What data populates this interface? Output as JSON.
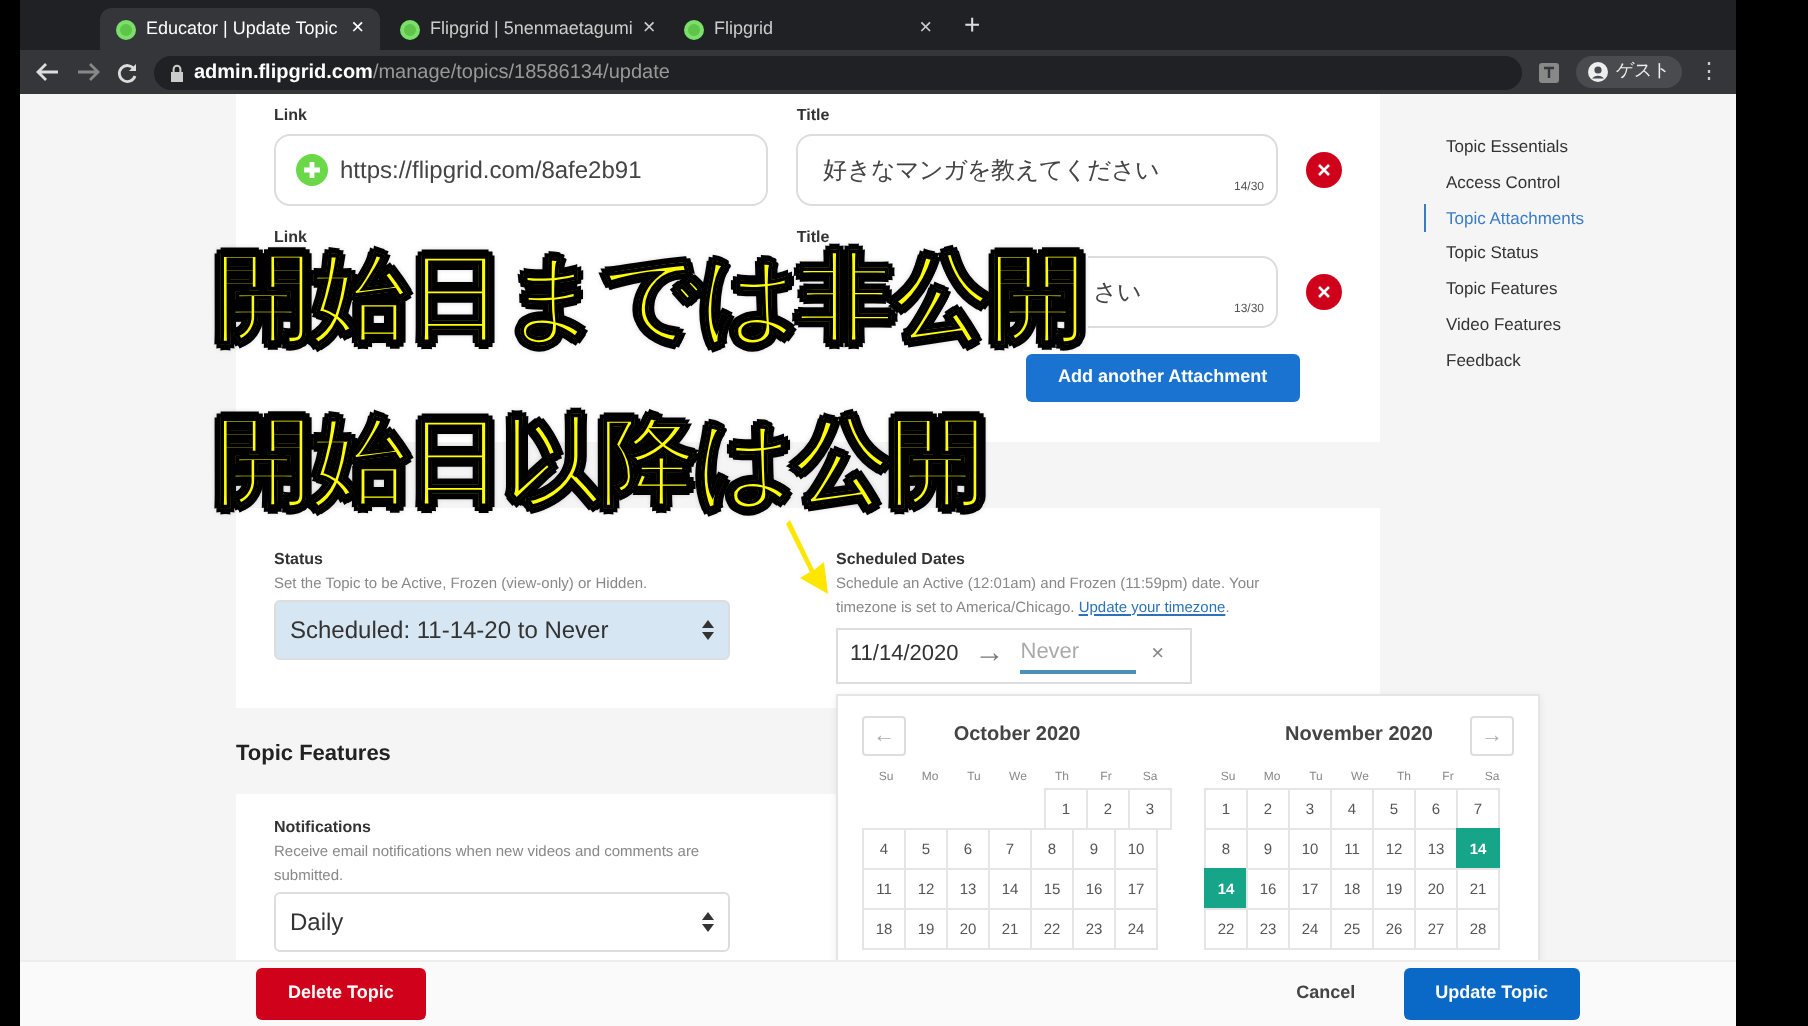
{
  "browser": {
    "tabs": [
      {
        "title": "Educator | Update Topic",
        "close": "×",
        "selected": true
      },
      {
        "title": "Flipgrid | 5nenmaetagumi",
        "close": "×",
        "selected": false
      },
      {
        "title": "Flipgrid",
        "close": "×",
        "selected": false
      }
    ],
    "new_tab": "+",
    "url_host": "admin.flipgrid.com",
    "url_path": "/manage/topics/18586134/update",
    "profile": "ゲスト",
    "menu": "⋮"
  },
  "attachments": [
    {
      "link_label": "Link",
      "link": "https://flipgrid.com/8afe2b91",
      "title_label": "Title",
      "title": "好きなマンガを教えてください",
      "count": "14/30",
      "covered": false
    },
    {
      "link_label": "Link",
      "title_label": "Title",
      "title": "さい",
      "count": "13/30",
      "covered": true
    }
  ],
  "add_button": "Add another Attachment",
  "caption": [
    "開始日までは非公開",
    "開始日以降は公開"
  ],
  "status": {
    "label": "Status",
    "description": "Set the Topic to be Active, Frozen (view-only) or Hidden.",
    "value": "Scheduled: 11-14-20 to Never"
  },
  "scheduled": {
    "label": "Scheduled Dates",
    "description": "Schedule an Active (12:01am) and Frozen (11:59pm) date. Your timezone is set to America/Chicago. ",
    "link": "Update your timezone",
    "suffix": ".",
    "start": "11/14/2020",
    "arrow": "→",
    "end_placeholder": "Never",
    "clear": "×"
  },
  "calendar": {
    "prev": "←",
    "next": "→",
    "months": [
      {
        "title": "October 2020",
        "weekdays": [
          "Su",
          "Mo",
          "Tu",
          "We",
          "Th",
          "Fr",
          "Sa"
        ],
        "weeks": [
          [
            {
              "day": "1",
              "selected": false
            },
            {
              "day": "2",
              "selected": false
            },
            {
              "day": "3",
              "selected": false
            }
          ],
          [
            {
              "day": "4",
              "selected": false
            },
            {
              "day": "5",
              "selected": false
            },
            {
              "day": "6",
              "selected": false
            },
            {
              "day": "7",
              "selected": false
            },
            {
              "day": "8",
              "selected": false
            },
            {
              "day": "9",
              "selected": false
            },
            {
              "day": "10",
              "selected": false
            }
          ],
          [
            {
              "day": "11",
              "selected": false
            },
            {
              "day": "12",
              "selected": false
            },
            {
              "day": "13",
              "selected": false
            },
            {
              "day": "14",
              "selected": false
            },
            {
              "day": "15",
              "selected": false
            },
            {
              "day": "16",
              "selected": false
            },
            {
              "day": "17",
              "selected": false
            }
          ],
          [
            {
              "day": "18",
              "selected": false
            },
            {
              "day": "19",
              "selected": false
            },
            {
              "day": "20",
              "selected": false
            },
            {
              "day": "21",
              "selected": false
            },
            {
              "day": "22",
              "selected": false
            },
            {
              "day": "23",
              "selected": false
            },
            {
              "day": "24",
              "selected": false
            }
          ]
        ]
      },
      {
        "title": "November 2020",
        "weekdays": [
          "Su",
          "Mo",
          "Tu",
          "We",
          "Th",
          "Fr",
          "Sa"
        ],
        "weeks": [
          [
            {
              "day": "1",
              "selected": false
            },
            {
              "day": "2",
              "selected": false
            },
            {
              "day": "3",
              "selected": false
            },
            {
              "day": "4",
              "selected": false
            },
            {
              "day": "5",
              "selected": false
            },
            {
              "day": "6",
              "selected": false
            },
            {
              "day": "7",
              "selected": false
            }
          ],
          [
            {
              "day": "8",
              "selected": false
            },
            {
              "day": "9",
              "selected": false
            },
            {
              "day": "10",
              "selected": false
            },
            {
              "day": "11",
              "selected": false
            },
            {
              "day": "12",
              "selected": false
            },
            {
              "day": "13",
              "selected": false
            },
            {
              "day": "14",
              "selected": true
            }
          ],
          [
            {
              "day": "14",
              "selected": true
            },
            {
              "day": "16",
              "selected": false
            },
            {
              "day": "17",
              "selected": false
            },
            {
              "day": "18",
              "selected": false
            },
            {
              "day": "19",
              "selected": false
            },
            {
              "day": "20",
              "selected": false
            },
            {
              "day": "21",
              "selected": false
            }
          ],
          [
            {
              "day": "22",
              "selected": false
            },
            {
              "day": "23",
              "selected": false
            },
            {
              "day": "24",
              "selected": false
            },
            {
              "day": "25",
              "selected": false
            },
            {
              "day": "26",
              "selected": false
            },
            {
              "day": "27",
              "selected": false
            },
            {
              "day": "28",
              "selected": false
            }
          ]
        ]
      }
    ]
  },
  "features": {
    "heading": "Topic Features",
    "label": "Notifications",
    "description": "Receive email notifications when new videos and comments are submitted.",
    "value": "Daily"
  },
  "side_nav": [
    {
      "label": "Topic Essentials",
      "selected": false
    },
    {
      "label": "Access Control",
      "selected": false
    },
    {
      "label": "Topic Attachments",
      "selected": true
    },
    {
      "label": "Topic Status",
      "selected": false
    },
    {
      "label": "Topic Features",
      "selected": false
    },
    {
      "label": "Video Features",
      "selected": false
    },
    {
      "label": "Feedback",
      "selected": false
    }
  ],
  "footer": {
    "delete": "Delete Topic",
    "cancel": "Cancel",
    "update": "Update Topic"
  }
}
